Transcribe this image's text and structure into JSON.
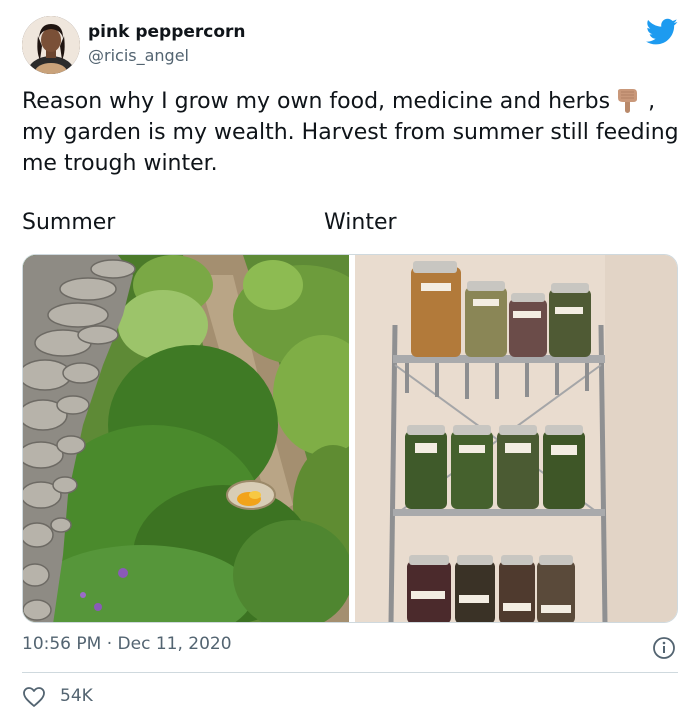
{
  "user": {
    "display_name": "pink peppercorn",
    "handle": "@ricis_angel",
    "avatar_icon": "avatar-photo"
  },
  "tweet": {
    "text_part1": "Reason why I grow my own food, medicine and herbs",
    "emoji_icon": "pointing-down-hand-emoji",
    "text_part2": ", my garden is my wealth. Harvest from summer still feeding me trough winter.",
    "label_left": "Summer",
    "label_right": "Winter",
    "timestamp": "10:56 PM · Dec 11, 2020",
    "likes": "54K"
  },
  "colors": {
    "twitter_blue": "#1d9bf0",
    "secondary_text": "#536471",
    "divider": "#cfd9de"
  },
  "icons": {
    "brand": "twitter-bird-icon",
    "info": "info-icon",
    "like": "heart-icon"
  }
}
